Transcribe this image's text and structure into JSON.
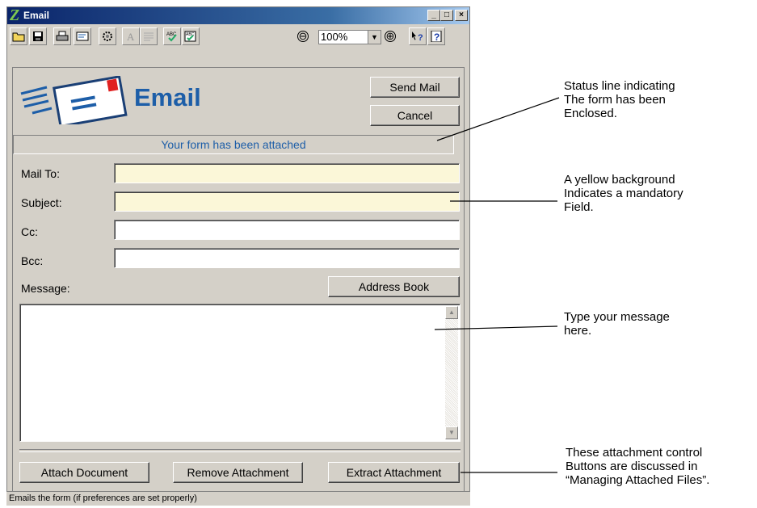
{
  "window": {
    "title": "Email",
    "controls": {
      "minimize": "_",
      "maximize": "□",
      "close": "×"
    }
  },
  "toolbar": {
    "zoom_value": "100%",
    "zoom_out_symbol": "⊖",
    "zoom_in_symbol": "⊕",
    "tools": [
      "open-folder-icon",
      "save-icon",
      "print-icon",
      "form-icon",
      "settings-icon",
      "font-icon",
      "paragraph-icon",
      "spell-check-icon",
      "spell-check-document-icon",
      "whats-this-icon",
      "help-icon"
    ]
  },
  "form": {
    "heading": "Email",
    "send_label": "Send Mail",
    "cancel_label": "Cancel",
    "status_text": "Your form has been attached",
    "mail_to_label": "Mail To:",
    "subject_label": "Subject:",
    "cc_label": "Cc:",
    "bcc_label": "Bcc:",
    "message_label": "Message:",
    "address_book_label": "Address Book",
    "mail_to_value": "",
    "subject_value": "",
    "cc_value": "",
    "bcc_value": "",
    "message_value": "",
    "attach_label": "Attach Document",
    "remove_label": "Remove Attachment",
    "extract_label": "Extract Attachment"
  },
  "statusbar": {
    "text": "Emails the form (if preferences are set properly)"
  },
  "colors": {
    "mandatory_field": "#fbf7d8",
    "heading_blue": "#1d5ea8",
    "window_face": "#d4d0c8"
  },
  "annotations": {
    "status_line": "Status line indicating\nThe form has been\nEnclosed.",
    "mandatory": "A yellow background\nIndicates a mandatory\nField.",
    "message": "Type your message\nhere.",
    "attachments": "These attachment control\nButtons are discussed in\n“Managing Attached Files”."
  }
}
